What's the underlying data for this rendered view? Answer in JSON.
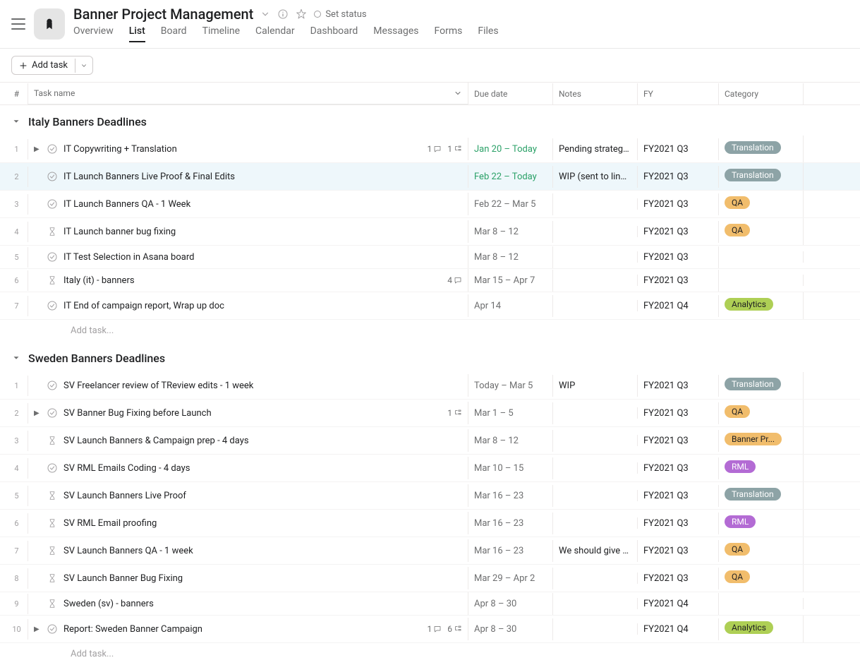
{
  "header": {
    "title": "Banner Project Management",
    "set_status": "Set status",
    "tabs": [
      "Overview",
      "List",
      "Board",
      "Timeline",
      "Calendar",
      "Dashboard",
      "Messages",
      "Forms",
      "Files"
    ],
    "active_tab": 1
  },
  "toolbar": {
    "add_task": "Add task"
  },
  "columns": {
    "num": "#",
    "name": "Task name",
    "due": "Due date",
    "notes": "Notes",
    "fy": "FY",
    "cat": "Category"
  },
  "tag_colors": {
    "Translation": "#8da3a6",
    "QA": "#f1bd6c",
    "Analytics": "#aecf55",
    "RML": "#b36bd4",
    "Banner Pr...": "#f1bd6c"
  },
  "sections": [
    {
      "title": "Italy Banners Deadlines",
      "add_label": "Add task...",
      "tasks": [
        {
          "num": "1",
          "icon": "check",
          "expand": true,
          "name": "IT Copywriting + Translation",
          "comments": "1",
          "subtasks": "1",
          "due": "Jan 20 – Today",
          "due_soon": true,
          "notes": "Pending strategy ...",
          "fy": "FY2021 Q3",
          "cat": "Translation"
        },
        {
          "num": "2",
          "icon": "check",
          "expand": false,
          "name": "IT Launch Banners Live Proof & Final Edits",
          "due": "Feb 22 – Today",
          "due_soon": true,
          "notes": "WIP (sent to lingu...",
          "fy": "FY2021 Q3",
          "cat": "Translation",
          "highlight": true
        },
        {
          "num": "3",
          "icon": "check",
          "expand": false,
          "name": "IT Launch Banners QA - 1 Week",
          "due": "Feb 22 – Mar 5",
          "notes": "",
          "fy": "FY2021 Q3",
          "cat": "QA"
        },
        {
          "num": "4",
          "icon": "hourglass",
          "expand": false,
          "name": "IT Launch banner bug fixing",
          "due": "Mar 8 – 12",
          "notes": "",
          "fy": "FY2021 Q3",
          "cat": "QA"
        },
        {
          "num": "5",
          "icon": "check",
          "expand": false,
          "name": "IT Test Selection in Asana board",
          "due": "Mar 8 – 12",
          "notes": "",
          "fy": "FY2021 Q3",
          "cat": ""
        },
        {
          "num": "6",
          "icon": "hourglass",
          "expand": false,
          "name": "Italy (it) - banners",
          "comments": "4",
          "due": "Mar 15 – Apr 7",
          "notes": "",
          "fy": "FY2021 Q3",
          "cat": ""
        },
        {
          "num": "7",
          "icon": "check",
          "expand": false,
          "name": "IT End of campaign report, Wrap up doc",
          "due": "Apr 14",
          "notes": "",
          "fy": "FY2021 Q4",
          "cat": "Analytics"
        }
      ]
    },
    {
      "title": "Sweden Banners Deadlines",
      "add_label": "Add task...",
      "tasks": [
        {
          "num": "1",
          "icon": "check",
          "expand": false,
          "name": "SV Freelancer review of TReview edits - 1 week",
          "due": "Today – Mar 5",
          "notes": "WIP",
          "fy": "FY2021 Q3",
          "cat": "Translation"
        },
        {
          "num": "2",
          "icon": "check",
          "expand": true,
          "name": "SV Banner Bug Fixing before Launch",
          "subtasks": "1",
          "due": "Mar 1 – 5",
          "notes": "",
          "fy": "FY2021 Q3",
          "cat": "QA"
        },
        {
          "num": "3",
          "icon": "hourglass",
          "expand": false,
          "name": "SV Launch Banners & Campaign prep - 4 days",
          "due": "Mar 8 – 12",
          "notes": "",
          "fy": "FY2021 Q3",
          "cat": "Banner Pr..."
        },
        {
          "num": "4",
          "icon": "check",
          "expand": false,
          "name": "SV RML Emails Coding - 4 days",
          "due": "Mar 10 – 15",
          "notes": "",
          "fy": "FY2021 Q3",
          "cat": "RML"
        },
        {
          "num": "5",
          "icon": "hourglass",
          "expand": false,
          "name": "SV Launch Banners Live Proof",
          "due": "Mar 16 – 23",
          "notes": "",
          "fy": "FY2021 Q3",
          "cat": "Translation"
        },
        {
          "num": "6",
          "icon": "hourglass",
          "expand": false,
          "name": "SV RML Email proofing",
          "due": "Mar 16 – 23",
          "notes": "",
          "fy": "FY2021 Q3",
          "cat": "RML"
        },
        {
          "num": "7",
          "icon": "hourglass",
          "expand": false,
          "name": "SV Launch Banners QA - 1 week",
          "due": "Mar 16 – 23",
          "notes": "We should give J...",
          "fy": "FY2021 Q3",
          "cat": "QA"
        },
        {
          "num": "8",
          "icon": "hourglass",
          "expand": false,
          "name": "SV Launch Banner Bug Fixing",
          "due": "Mar 29 – Apr 2",
          "notes": "",
          "fy": "FY2021 Q3",
          "cat": "QA"
        },
        {
          "num": "9",
          "icon": "hourglass",
          "expand": false,
          "name": "Sweden (sv) - banners",
          "due": "Apr 8 – 30",
          "notes": "",
          "fy": "FY2021 Q4",
          "cat": ""
        },
        {
          "num": "10",
          "icon": "check",
          "expand": true,
          "name": "Report: Sweden Banner Campaign",
          "comments": "1",
          "subtasks": "6",
          "due": "Apr 8 – 30",
          "notes": "",
          "fy": "FY2021 Q4",
          "cat": "Analytics"
        }
      ]
    }
  ]
}
